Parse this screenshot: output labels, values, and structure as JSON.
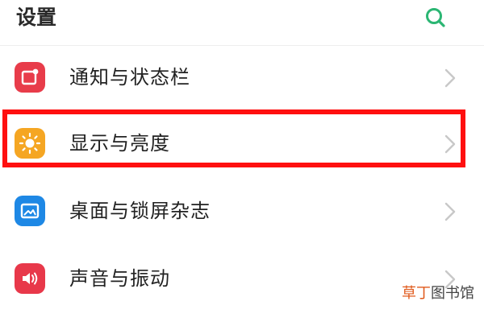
{
  "header": {
    "title": "设置",
    "search_icon": "search-icon"
  },
  "items": [
    {
      "label": "通知与状态栏",
      "icon": "notification-icon",
      "icon_color": "#e83c4a"
    },
    {
      "label": "显示与亮度",
      "icon": "brightness-icon",
      "icon_color": "#f5a623"
    },
    {
      "label": "桌面与锁屏杂志",
      "icon": "wallpaper-icon",
      "icon_color": "#1e88e5"
    },
    {
      "label": "声音与振动",
      "icon": "sound-icon",
      "icon_color": "#e8384a"
    }
  ],
  "highlight": {
    "target": "显示与亮度",
    "color": "#ff1010"
  },
  "watermark": {
    "accent": "草丁",
    "rest": "图书馆"
  },
  "colors": {
    "accent": "#2bb673",
    "chevron": "#c8c8c8"
  }
}
